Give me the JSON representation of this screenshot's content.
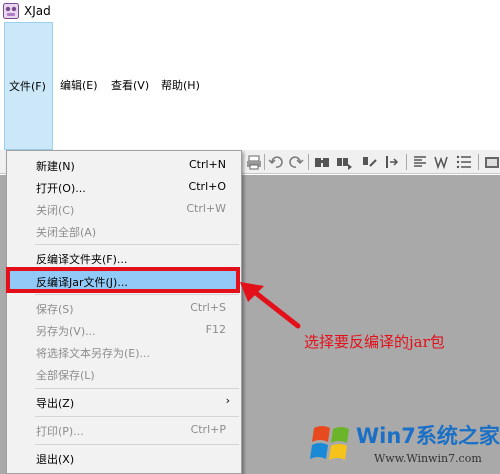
{
  "window": {
    "title": "XJad"
  },
  "menubar": {
    "items": [
      {
        "label": "文件(F)"
      },
      {
        "label": "编辑(E)"
      },
      {
        "label": "查看(V)"
      },
      {
        "label": "帮助(H)"
      }
    ]
  },
  "file_menu": {
    "items": [
      {
        "label": "新建(N)",
        "shortcut": "Ctrl+N"
      },
      {
        "label": "打开(O)...",
        "shortcut": "Ctrl+O"
      },
      {
        "label": "关闭(C)",
        "shortcut": "Ctrl+W"
      },
      {
        "label": "关闭全部(A)",
        "shortcut": ""
      },
      {
        "label": "反编译文件夹(F)...",
        "shortcut": ""
      },
      {
        "label": "反编译Jar文件(J)...",
        "shortcut": ""
      },
      {
        "label": "保存(S)",
        "shortcut": "Ctrl+S"
      },
      {
        "label": "另存为(V)...",
        "shortcut": "F12"
      },
      {
        "label": "将选择文本另存为(E)...",
        "shortcut": ""
      },
      {
        "label": "全部保存(L)",
        "shortcut": ""
      },
      {
        "label": "导出(Z)",
        "shortcut": ""
      },
      {
        "label": "打印(P)...",
        "shortcut": "Ctrl+P"
      },
      {
        "label": "退出(X)",
        "shortcut": ""
      }
    ]
  },
  "annotation": {
    "text": "选择要反编译的jar包"
  },
  "watermark": {
    "text": "Win7系统之家",
    "url": "Www.Winwin7.com"
  },
  "colors": {
    "highlight": "#91c9f7",
    "annotation_red": "#e3101a",
    "workspace": "#a9a9a9"
  }
}
